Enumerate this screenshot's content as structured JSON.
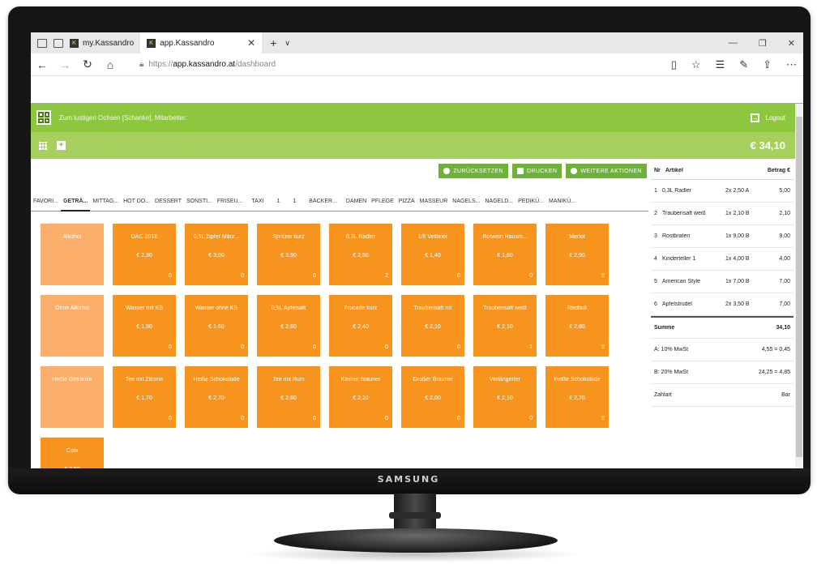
{
  "brand": "SAMSUNG",
  "browser": {
    "tabs": [
      {
        "label": "my.Kassandro"
      },
      {
        "label": "app.Kassandro"
      }
    ],
    "url_prefix": "https://",
    "url_host": "app.kassandro.at",
    "url_path": "/dashboard"
  },
  "app": {
    "header_text": "Zum lustigen Ochsen [Schanke], Mitarbeiter:",
    "logout_label": "Logout",
    "total": "€ 34,10",
    "actions": [
      "ZURÜCKSETZEN",
      "DRUCKEN",
      "WEITERE AKTIONEN"
    ],
    "categories": [
      "FAVORI...",
      "GETRÄ...",
      "MITTAG...",
      "HOT DO...",
      "DESSERT",
      "SONSTI...",
      "FRISEU...",
      "TAXI",
      "1",
      "1",
      "BÄCKER...",
      "DAMEN",
      "PFLEGE",
      "PIZZA",
      "MASSEUR",
      "NAGELS...",
      "NAGELD...",
      "PEDIKÜ...",
      "MANIKÜ..."
    ],
    "active_category": 1,
    "product_rows": [
      [
        {
          "name": "Alkohol",
          "group": true
        },
        {
          "name": "DAC 2016",
          "price": "€ 2,30",
          "count": "0"
        },
        {
          "name": "0,5L Zipfer März...",
          "price": "€ 3,00",
          "count": "0"
        },
        {
          "name": "Spritzer kurz",
          "price": "€ 3,90",
          "count": "0"
        },
        {
          "name": "0,3L Radler",
          "price": "€ 2,50",
          "count": "2"
        },
        {
          "name": "1/8 Veltliner",
          "price": "€ 1,40",
          "count": "0"
        },
        {
          "name": "Rotwein Hausm...",
          "price": "€ 1,80",
          "count": "0"
        },
        {
          "name": "Merlot",
          "price": "€ 2,90",
          "count": "0"
        }
      ],
      [
        {
          "name": "Ohne Alkohol",
          "group": true
        },
        {
          "name": "Wasser mit KS",
          "price": "€ 1,90",
          "count": "0"
        },
        {
          "name": "Wasser ohne KS",
          "price": "€ 1,60",
          "count": "0"
        },
        {
          "name": "0,5L Apfelsaft",
          "price": "€ 2,60",
          "count": "0"
        },
        {
          "name": "Frucade kurz",
          "price": "€ 2,40",
          "count": "0"
        },
        {
          "name": "Traubensaft rot",
          "price": "€ 2,10",
          "count": "0"
        },
        {
          "name": "Traubensaft weiß",
          "price": "€ 2,10",
          "count": "1"
        },
        {
          "name": "Redbull",
          "price": "€ 2,80",
          "count": "0"
        }
      ],
      [
        {
          "name": "Heiße Getränke",
          "group": true
        },
        {
          "name": "Tee mit Zitrone",
          "price": "€ 1,70",
          "count": "0"
        },
        {
          "name": "Heiße Schokolade",
          "price": "€ 2,70",
          "count": "0"
        },
        {
          "name": "Tee mit Rum",
          "price": "€ 2,60",
          "count": "0"
        },
        {
          "name": "Kleiner Brauner",
          "price": "€ 2,10",
          "count": "0"
        },
        {
          "name": "Großer Brauner",
          "price": "€ 2,60",
          "count": "0"
        },
        {
          "name": "Verlängerter",
          "price": "€ 2,10",
          "count": "0"
        },
        {
          "name": "Heiße Schokolade",
          "price": "€ 2,70",
          "count": "0"
        }
      ],
      [
        {
          "name": "Cola",
          "price": "€ 2,50",
          "count": "0"
        }
      ]
    ],
    "receipt": {
      "headers": {
        "nr": "Nr",
        "article": "Artikel",
        "amount": "Betrag €"
      },
      "items": [
        {
          "nr": "1",
          "article": "0,3L Radler",
          "qty": "2x 2,50 A",
          "amount": "5,00"
        },
        {
          "nr": "2",
          "article": "Traubensaft weiß",
          "qty": "1x 2,10 B",
          "amount": "2,10"
        },
        {
          "nr": "3",
          "article": "Rostbraten",
          "qty": "1x 9,00 B",
          "amount": "9,00"
        },
        {
          "nr": "4",
          "article": "Kinderteller 1",
          "qty": "1x 4,00 B",
          "amount": "4,00"
        },
        {
          "nr": "5",
          "article": "American Style",
          "qty": "1x 7,00 B",
          "amount": "7,00"
        },
        {
          "nr": "6",
          "article": "Apfelstrudel",
          "qty": "2x 3,50 B",
          "amount": "7,00"
        }
      ],
      "sum_label": "Summe",
      "sum_value": "34,10",
      "taxes": [
        {
          "label": "A: 10% MwSt",
          "value": "4,55 = 0,45"
        },
        {
          "label": "B: 20% MwSt",
          "value": "24,25 = 4,85"
        }
      ],
      "payment_label": "Zahlart",
      "payment_value": "Bar"
    }
  },
  "colors": {
    "green": "#8dc63f",
    "green_light": "#a5d05e",
    "orange": "#f7941d",
    "orange_light": "#fbad6a"
  }
}
